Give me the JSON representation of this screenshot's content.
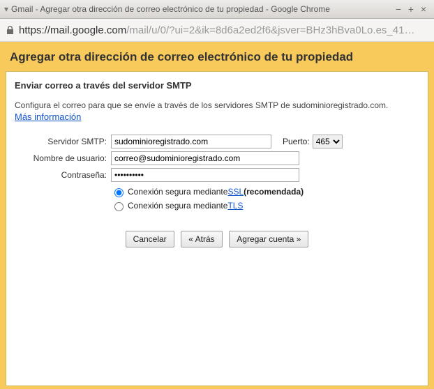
{
  "window": {
    "title": "Gmail - Agregar otra dirección de correo electrónico de tu propiedad - Google Chrome"
  },
  "address": {
    "host": "https://mail.google.com",
    "rest": "/mail/u/0/?ui=2&ik=8d6a2ed2f6&jsver=BHz3hBva0Lo.es_41…"
  },
  "page": {
    "title": "Agregar otra dirección de correo electrónico de tu propiedad"
  },
  "panel": {
    "heading": "Enviar correo a través del servidor SMTP",
    "helptext": "Configura el correo para que se envíe a través de los servidores SMTP de sudominioregistrado.com.",
    "more_info": "Más información"
  },
  "form": {
    "smtp_label": "Servidor SMTP:",
    "smtp_value": "sudominioregistrado.com",
    "port_label": "Puerto:",
    "port_value": "465",
    "user_label": "Nombre de usuario:",
    "user_value": "correo@sudominioregistrado.com",
    "pass_label": "Contraseña:",
    "pass_value": "••••••••••",
    "ssl_prefix": "Conexión segura mediante ",
    "ssl_link": "SSL",
    "ssl_suffix": " (recomendada)",
    "tls_prefix": "Conexión segura mediante ",
    "tls_link": "TLS"
  },
  "buttons": {
    "cancel": "Cancelar",
    "back": "« Atrás",
    "add": "Agregar cuenta »"
  }
}
